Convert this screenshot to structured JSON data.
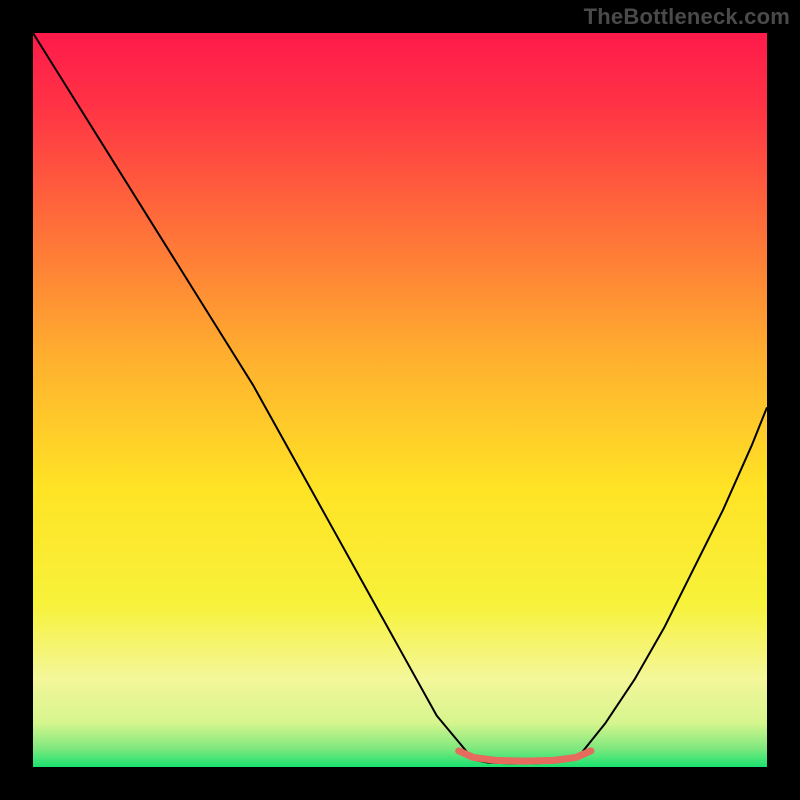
{
  "watermark": "TheBottleneck.com",
  "chart_data": {
    "type": "line",
    "title": "",
    "xlabel": "",
    "ylabel": "",
    "xlim": [
      0,
      100
    ],
    "ylim": [
      0,
      100
    ],
    "grid": false,
    "legend": false,
    "gradient_stops": [
      {
        "pos": 0.0,
        "color": "#ff1a4b"
      },
      {
        "pos": 0.1,
        "color": "#ff3345"
      },
      {
        "pos": 0.25,
        "color": "#ff6a3a"
      },
      {
        "pos": 0.45,
        "color": "#ffb22e"
      },
      {
        "pos": 0.62,
        "color": "#ffe325"
      },
      {
        "pos": 0.78,
        "color": "#f7f23b"
      },
      {
        "pos": 0.88,
        "color": "#f4f79a"
      },
      {
        "pos": 0.94,
        "color": "#d6f58e"
      },
      {
        "pos": 0.975,
        "color": "#7ee87e"
      },
      {
        "pos": 1.0,
        "color": "#19e270"
      }
    ],
    "series": [
      {
        "name": "bottleneck-curve-left",
        "color": "#000000",
        "width": 2,
        "x": [
          0,
          5,
          10,
          15,
          20,
          25,
          30,
          35,
          40,
          45,
          50,
          55,
          60
        ],
        "y": [
          100,
          92,
          84,
          76,
          68,
          60,
          52,
          43,
          34,
          25,
          16,
          7,
          1
        ]
      },
      {
        "name": "bottleneck-flat",
        "color": "#000000",
        "width": 2,
        "x": [
          60,
          62,
          65,
          68,
          71,
          74
        ],
        "y": [
          1,
          0.6,
          0.5,
          0.5,
          0.6,
          1
        ]
      },
      {
        "name": "bottleneck-curve-right",
        "color": "#000000",
        "width": 2,
        "x": [
          74,
          78,
          82,
          86,
          90,
          94,
          98,
          100
        ],
        "y": [
          1,
          6,
          12,
          19,
          27,
          35,
          44,
          49
        ]
      },
      {
        "name": "optimal-marker",
        "color": "#e66a5e",
        "width": 7,
        "cap": "round",
        "x": [
          58,
          60,
          63,
          67,
          71,
          74,
          76
        ],
        "y": [
          2.2,
          1.3,
          0.9,
          0.8,
          0.9,
          1.3,
          2.2
        ]
      }
    ]
  }
}
